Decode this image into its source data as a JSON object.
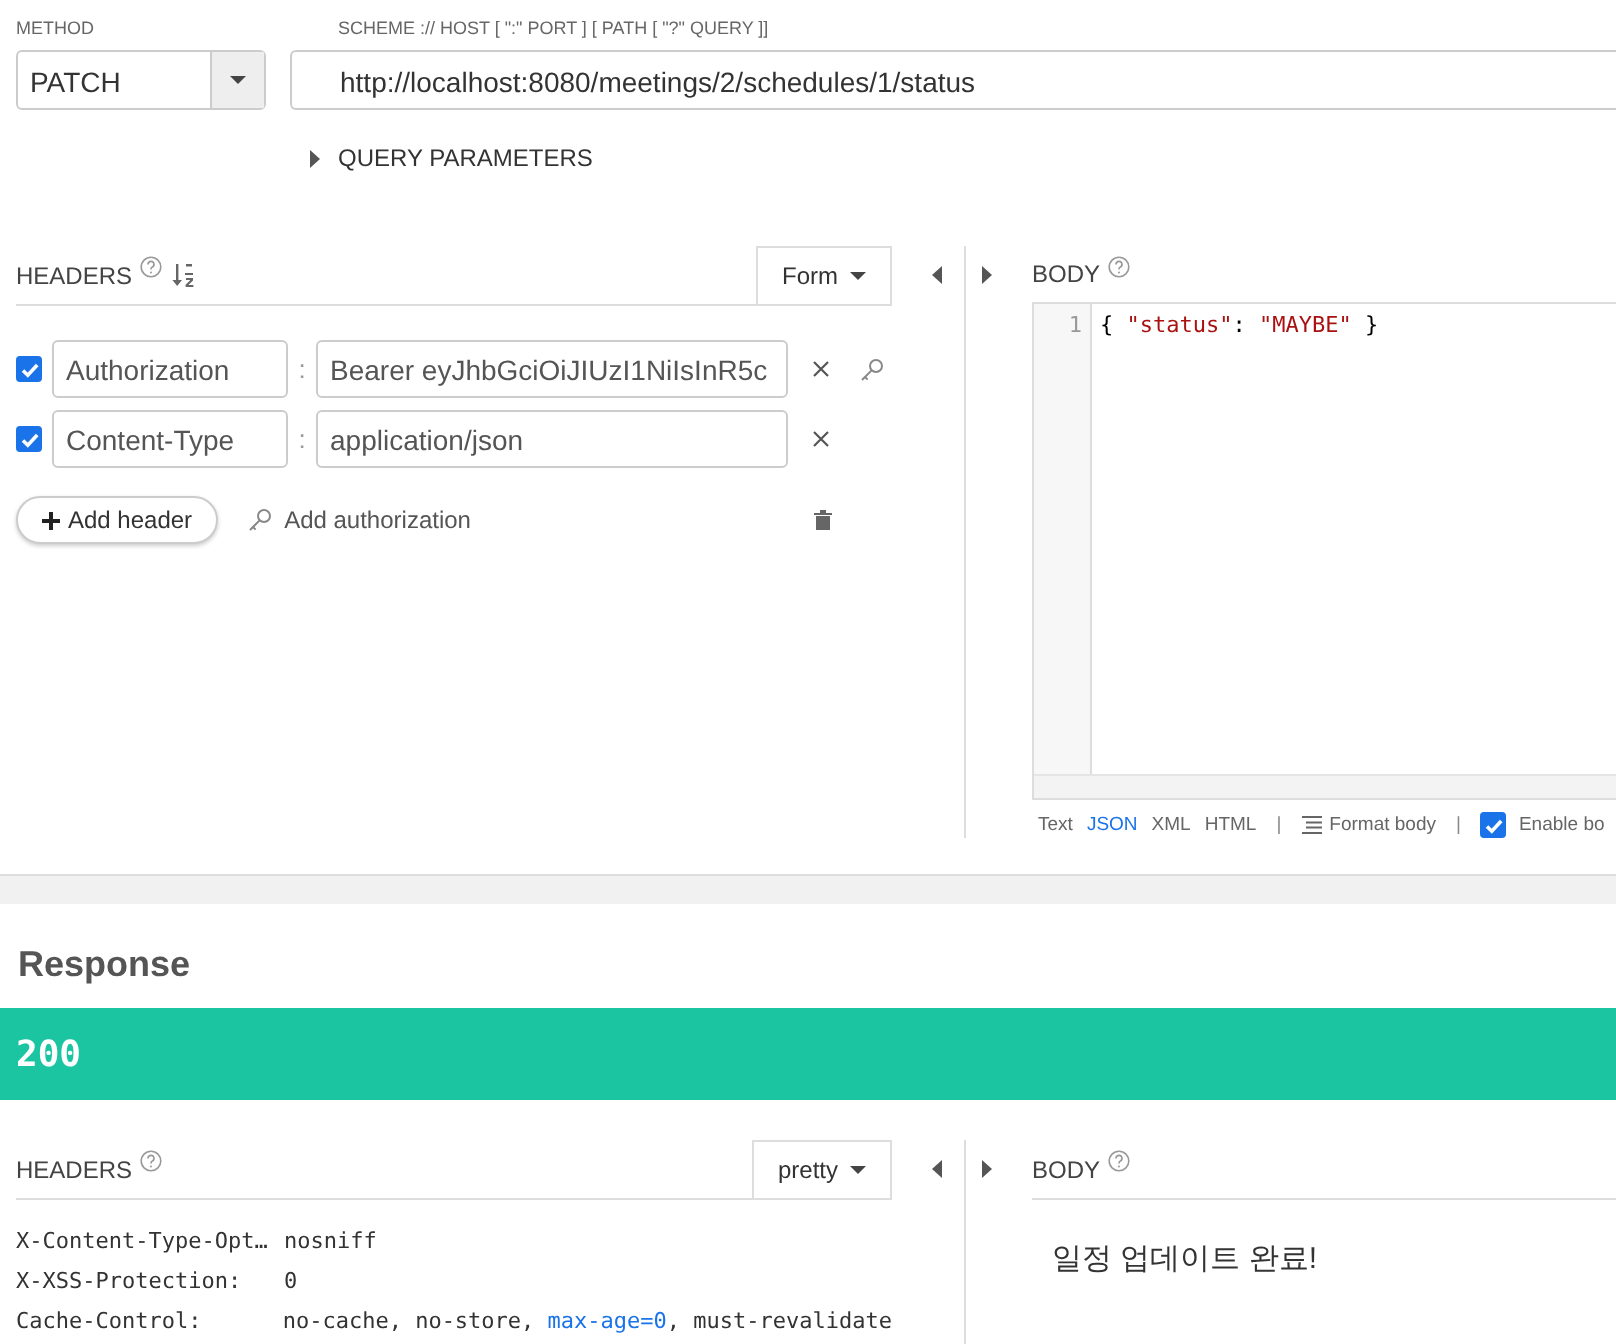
{
  "request": {
    "method": {
      "label": "METHOD",
      "value": "PATCH"
    },
    "url": {
      "label": "SCHEME :// HOST [ \":\" PORT ] [ PATH [ \"?\" QUERY ]]",
      "value": "http://localhost:8080/meetings/2/schedules/1/status"
    },
    "query_parameters": {
      "label": "QUERY PARAMETERS",
      "expanded": false
    },
    "headers": {
      "title": "HEADERS",
      "mode": "Form",
      "rows": [
        {
          "checked": true,
          "name": "Authorization",
          "separator": ":",
          "value": "Bearer eyJhbGciOiJIUzI1NiIsInR5c",
          "kind": "authorization"
        },
        {
          "checked": true,
          "name": "Content-Type",
          "separator": ":",
          "value": "application/json",
          "kind": "plain"
        }
      ],
      "add_header": "Add header",
      "add_authorization": "Add authorization"
    },
    "body": {
      "title": "BODY",
      "lines": [
        {
          "number": "1",
          "tokens": [
            {
              "text": "{ ",
              "kind": "punct"
            },
            {
              "text": "\"status\"",
              "kind": "string"
            },
            {
              "text": ": ",
              "kind": "punct"
            },
            {
              "text": "\"MAYBE\"",
              "kind": "string"
            },
            {
              "text": " }",
              "kind": "punct"
            }
          ]
        }
      ],
      "formats": [
        {
          "label": "Text",
          "selected": false
        },
        {
          "label": "JSON",
          "selected": true
        },
        {
          "label": "XML",
          "selected": false
        },
        {
          "label": "HTML",
          "selected": false
        }
      ],
      "dividers": [
        "|",
        "|"
      ],
      "format_body": "Format body",
      "enable_body": {
        "label": "Enable bo",
        "checked": true
      }
    }
  },
  "response": {
    "title": "Response",
    "status": "200",
    "headers": {
      "title": "HEADERS",
      "mode": "pretty",
      "rows": [
        {
          "name": "X-Content-Type-Opt…",
          "parts": [
            {
              "text": "nosniff",
              "kind": "plain"
            }
          ]
        },
        {
          "name": "X-XSS-Protection:",
          "parts": [
            {
              "text": "0",
              "kind": "plain"
            }
          ]
        },
        {
          "name": "Cache-Control:",
          "parts": [
            {
              "text": "no-cache, no-store, ",
              "kind": "plain"
            },
            {
              "text": "max-age=0",
              "kind": "link"
            },
            {
              "text": ", must-revalidate",
              "kind": "plain"
            }
          ]
        }
      ]
    },
    "body": {
      "title": "BODY",
      "text": "일정 업데이트 완료!"
    }
  }
}
